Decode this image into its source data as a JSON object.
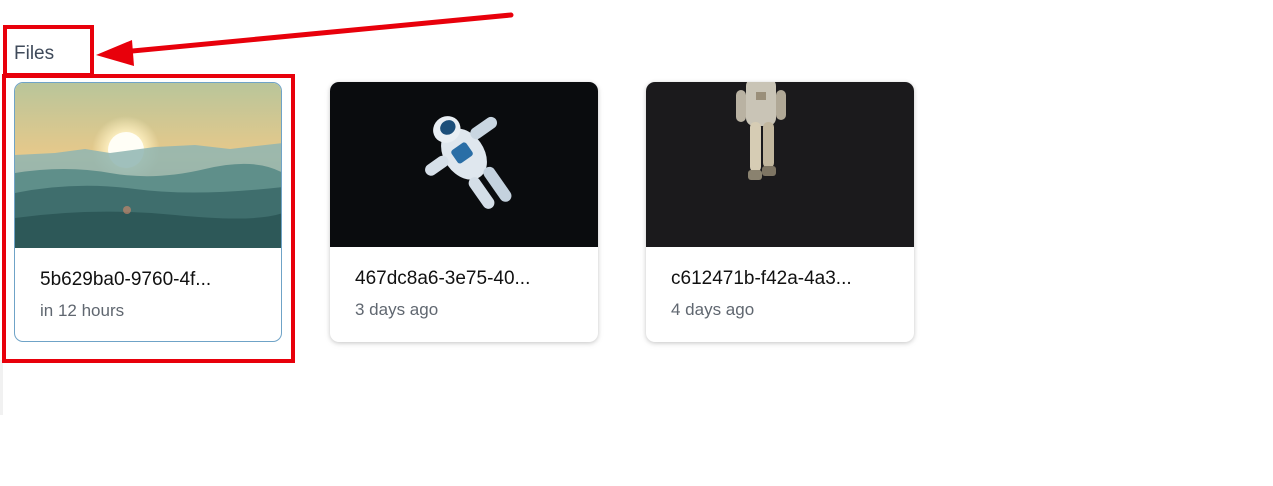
{
  "section": {
    "title": "Files"
  },
  "files": [
    {
      "name": "5b629ba0-9760-4f...",
      "time": "in 12 hours",
      "thumbnail": "sunset-over-hills"
    },
    {
      "name": "467dc8a6-3e75-40...",
      "time": "3 days ago",
      "thumbnail": "astronaut-floating-dark"
    },
    {
      "name": "c612471b-f42a-4a3...",
      "time": "4 days ago",
      "thumbnail": "astronaut-standing-dark"
    }
  ],
  "colors": {
    "annotation": "#e8000b",
    "selected_border": "#6fa3c7",
    "title_text": "#3f4a5a",
    "secondary_text": "#606770"
  }
}
